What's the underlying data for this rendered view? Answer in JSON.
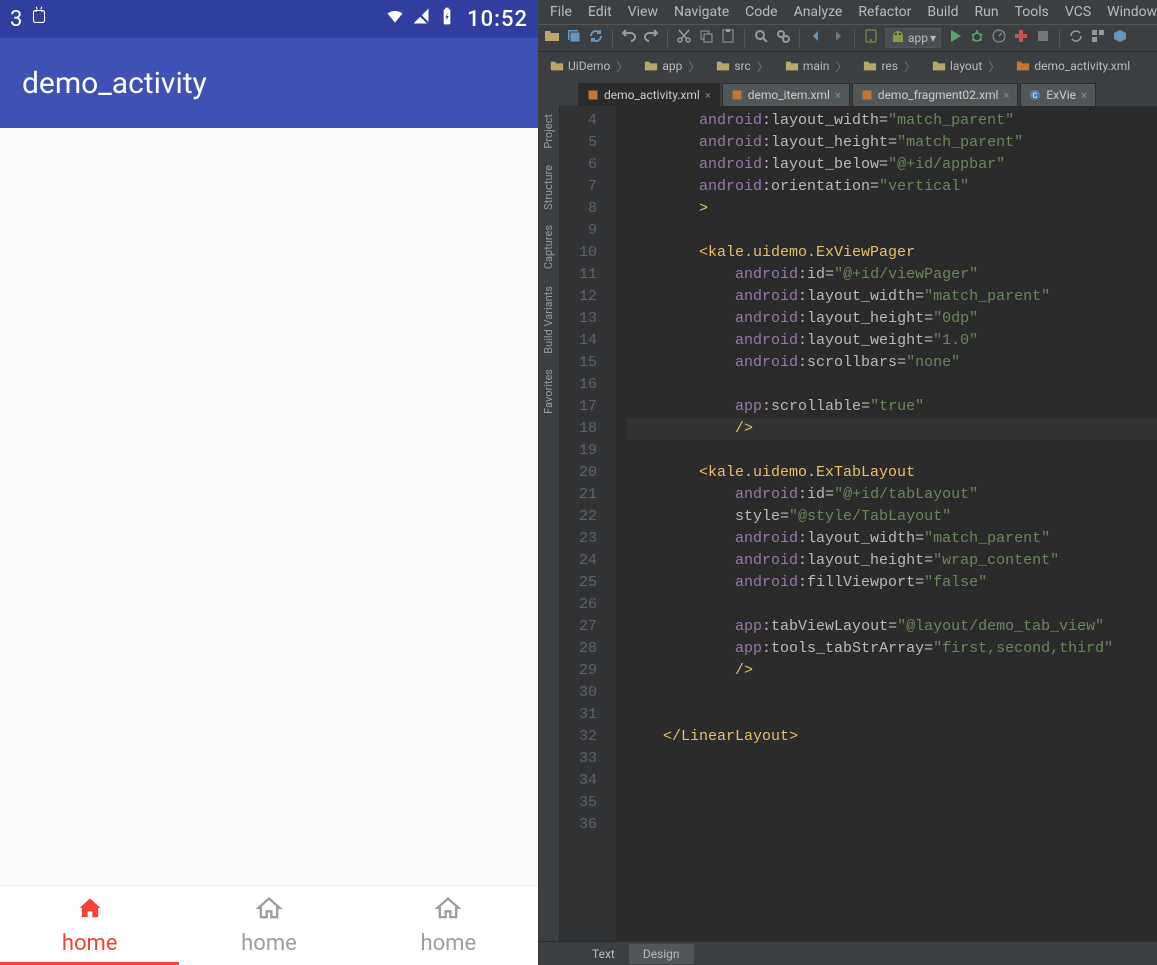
{
  "emulator": {
    "status_left_number": "3",
    "clock": "10:52",
    "app_title": "demo_activity",
    "tabs": [
      "home",
      "home",
      "home"
    ]
  },
  "ide": {
    "menu": [
      "File",
      "Edit",
      "View",
      "Navigate",
      "Code",
      "Analyze",
      "Refactor",
      "Build",
      "Run",
      "Tools",
      "VCS",
      "Window"
    ],
    "run_config": "app",
    "breadcrumbs": [
      "UiDemo",
      "app",
      "src",
      "main",
      "res",
      "layout",
      "demo_activity.xml"
    ],
    "tabs": [
      {
        "label": "demo_activity.xml",
        "icon": "xml",
        "active": true
      },
      {
        "label": "demo_item.xml",
        "icon": "xml",
        "active": false
      },
      {
        "label": "demo_fragment02.xml",
        "icon": "xml",
        "active": false
      },
      {
        "label": "ExVie",
        "icon": "class",
        "active": false
      }
    ],
    "side_left": [
      "Project",
      "Structure",
      "Captures",
      "Build Variants",
      "Favorites"
    ],
    "bottom_tabs": [
      "Text",
      "Design"
    ],
    "line_start": 4,
    "line_end": 36,
    "highlight_line": 18,
    "code": [
      {
        "n": 4,
        "seg": [
          {
            "t": "        "
          },
          {
            "c": "ns",
            "t": "android"
          },
          {
            "c": "attr",
            "t": ":layout_width="
          },
          {
            "c": "str",
            "t": "\"match_parent\""
          }
        ]
      },
      {
        "n": 5,
        "seg": [
          {
            "t": "        "
          },
          {
            "c": "ns",
            "t": "android"
          },
          {
            "c": "attr",
            "t": ":layout_height="
          },
          {
            "c": "str",
            "t": "\"match_parent\""
          }
        ]
      },
      {
        "n": 6,
        "seg": [
          {
            "t": "        "
          },
          {
            "c": "ns",
            "t": "android"
          },
          {
            "c": "attr",
            "t": ":layout_below="
          },
          {
            "c": "str",
            "t": "\"@+id/appbar\""
          }
        ]
      },
      {
        "n": 7,
        "seg": [
          {
            "t": "        "
          },
          {
            "c": "ns",
            "t": "android"
          },
          {
            "c": "attr",
            "t": ":orientation="
          },
          {
            "c": "str",
            "t": "\"vertical\""
          }
        ]
      },
      {
        "n": 8,
        "seg": [
          {
            "t": "        "
          },
          {
            "c": "punc",
            "t": ">"
          }
        ]
      },
      {
        "n": 9,
        "seg": [
          {
            "t": " "
          }
        ]
      },
      {
        "n": 10,
        "seg": [
          {
            "t": "        "
          },
          {
            "c": "punc",
            "t": "<"
          },
          {
            "c": "tag",
            "t": "kale.uidemo.ExViewPager"
          }
        ]
      },
      {
        "n": 11,
        "seg": [
          {
            "t": "            "
          },
          {
            "c": "ns",
            "t": "android"
          },
          {
            "c": "attr",
            "t": ":id="
          },
          {
            "c": "str",
            "t": "\"@+id/viewPager\""
          }
        ]
      },
      {
        "n": 12,
        "seg": [
          {
            "t": "            "
          },
          {
            "c": "ns",
            "t": "android"
          },
          {
            "c": "attr",
            "t": ":layout_width="
          },
          {
            "c": "str",
            "t": "\"match_parent\""
          }
        ]
      },
      {
        "n": 13,
        "seg": [
          {
            "t": "            "
          },
          {
            "c": "ns",
            "t": "android"
          },
          {
            "c": "attr",
            "t": ":layout_height="
          },
          {
            "c": "str",
            "t": "\"0dp\""
          }
        ]
      },
      {
        "n": 14,
        "seg": [
          {
            "t": "            "
          },
          {
            "c": "ns",
            "t": "android"
          },
          {
            "c": "attr",
            "t": ":layout_weight="
          },
          {
            "c": "str",
            "t": "\"1.0\""
          }
        ]
      },
      {
        "n": 15,
        "seg": [
          {
            "t": "            "
          },
          {
            "c": "ns",
            "t": "android"
          },
          {
            "c": "attr",
            "t": ":scrollbars="
          },
          {
            "c": "str",
            "t": "\"none\""
          }
        ]
      },
      {
        "n": 16,
        "seg": [
          {
            "t": " "
          }
        ]
      },
      {
        "n": 17,
        "seg": [
          {
            "t": "            "
          },
          {
            "c": "ns",
            "t": "app"
          },
          {
            "c": "attr",
            "t": ":scrollable="
          },
          {
            "c": "str",
            "t": "\"true\""
          }
        ]
      },
      {
        "n": 18,
        "seg": [
          {
            "t": "            "
          },
          {
            "c": "punc",
            "t": "/>"
          }
        ]
      },
      {
        "n": 19,
        "seg": [
          {
            "t": " "
          }
        ]
      },
      {
        "n": 20,
        "seg": [
          {
            "t": "        "
          },
          {
            "c": "punc",
            "t": "<"
          },
          {
            "c": "tag",
            "t": "kale.uidemo.ExTabLayout"
          }
        ]
      },
      {
        "n": 21,
        "seg": [
          {
            "t": "            "
          },
          {
            "c": "ns",
            "t": "android"
          },
          {
            "c": "attr",
            "t": ":id="
          },
          {
            "c": "str",
            "t": "\"@+id/tabLayout\""
          }
        ]
      },
      {
        "n": 22,
        "seg": [
          {
            "t": "            "
          },
          {
            "c": "attr",
            "t": "style="
          },
          {
            "c": "str",
            "t": "\"@style/TabLayout\""
          }
        ]
      },
      {
        "n": 23,
        "seg": [
          {
            "t": "            "
          },
          {
            "c": "ns",
            "t": "android"
          },
          {
            "c": "attr",
            "t": ":layout_width="
          },
          {
            "c": "str",
            "t": "\"match_parent\""
          }
        ]
      },
      {
        "n": 24,
        "seg": [
          {
            "t": "            "
          },
          {
            "c": "ns",
            "t": "android"
          },
          {
            "c": "attr",
            "t": ":layout_height="
          },
          {
            "c": "str",
            "t": "\"wrap_content\""
          }
        ]
      },
      {
        "n": 25,
        "seg": [
          {
            "t": "            "
          },
          {
            "c": "ns",
            "t": "android"
          },
          {
            "c": "attr",
            "t": ":fillViewport="
          },
          {
            "c": "str",
            "t": "\"false\""
          }
        ]
      },
      {
        "n": 26,
        "seg": [
          {
            "t": " "
          }
        ]
      },
      {
        "n": 27,
        "seg": [
          {
            "t": "            "
          },
          {
            "c": "ns",
            "t": "app"
          },
          {
            "c": "attr",
            "t": ":tabViewLayout="
          },
          {
            "c": "str",
            "t": "\"@layout/demo_tab_view\""
          }
        ]
      },
      {
        "n": 28,
        "seg": [
          {
            "t": "            "
          },
          {
            "c": "ns",
            "t": "app"
          },
          {
            "c": "attr",
            "t": ":tools_tabStrArray="
          },
          {
            "c": "str",
            "t": "\"first,second,third\""
          }
        ]
      },
      {
        "n": 29,
        "seg": [
          {
            "t": "            "
          },
          {
            "c": "punc",
            "t": "/>"
          }
        ]
      },
      {
        "n": 30,
        "seg": [
          {
            "t": " "
          }
        ]
      },
      {
        "n": 31,
        "seg": [
          {
            "t": " "
          }
        ]
      },
      {
        "n": 32,
        "seg": [
          {
            "t": "    "
          },
          {
            "c": "punc",
            "t": "</"
          },
          {
            "c": "tag",
            "t": "LinearLayout"
          },
          {
            "c": "punc",
            "t": ">"
          }
        ]
      },
      {
        "n": 33,
        "seg": [
          {
            "t": " "
          }
        ]
      },
      {
        "n": 34,
        "seg": [
          {
            "t": " "
          }
        ]
      },
      {
        "n": 35,
        "seg": [
          {
            "t": " "
          }
        ]
      },
      {
        "n": 36,
        "seg": [
          {
            "t": " "
          }
        ]
      }
    ]
  }
}
